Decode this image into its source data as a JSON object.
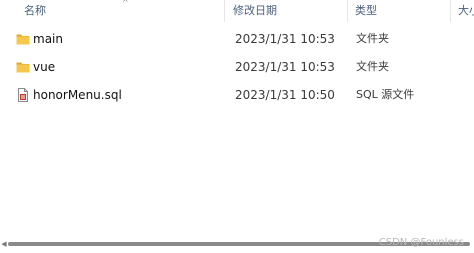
{
  "columns": {
    "name": "名称",
    "modified": "修改日期",
    "type": "类型",
    "size": "大小"
  },
  "files": [
    {
      "name": "main",
      "modified": "2023/1/31 10:53",
      "type": "文件夹",
      "icon": "folder-icon"
    },
    {
      "name": "vue",
      "modified": "2023/1/31 10:53",
      "type": "文件夹",
      "icon": "folder-icon"
    },
    {
      "name": "honorMenu.sql",
      "modified": "2023/1/31 10:50",
      "type": "SQL 源文件",
      "icon": "sql-file-icon"
    }
  ],
  "watermark": "CSDN @Founless",
  "colors": {
    "folder": "#f5c84c",
    "folder_dark": "#e0a92a",
    "header_text": "#4c607a",
    "sql_accent": "#c0392b"
  }
}
